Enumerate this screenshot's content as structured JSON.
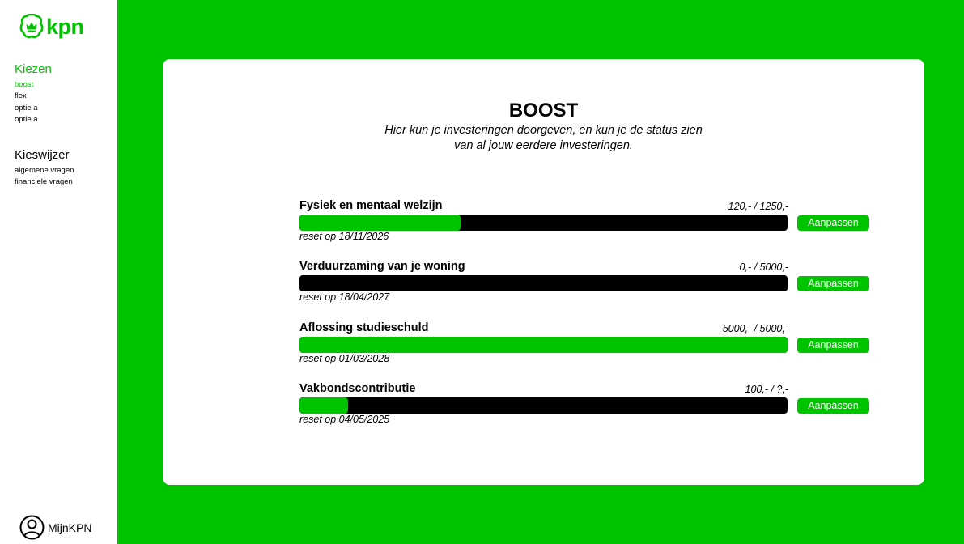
{
  "brand": {
    "name": "kpn",
    "color": "#00c300",
    "logo_icon": "kpn-crown-logo-icon"
  },
  "sidebar": {
    "groups": [
      {
        "title": "Kiezen",
        "items": [
          {
            "label": "boost",
            "active": true
          },
          {
            "label": "flex"
          },
          {
            "label": "optie a"
          },
          {
            "label": "optie a"
          }
        ]
      },
      {
        "title": "Kieswijzer",
        "items": [
          {
            "label": "algemene vragen"
          },
          {
            "label": "financiele vragen"
          }
        ]
      }
    ],
    "account": {
      "label": "MijnKPN",
      "icon": "user-avatar-icon"
    }
  },
  "main": {
    "title": "BOOST",
    "subtitle_lines": [
      "Hier kun je investeringen doorgeven, en kun je de status zien",
      "van al jouw eerdere investeringen."
    ],
    "goals": [
      {
        "name": "Fysiek en mentaal welzijn",
        "amount": "120,- / 1250,-",
        "progress": 0.33,
        "reset": "reset op 18/11/2026",
        "button": "Aanpassen"
      },
      {
        "name": "Verduurzaming van je woning",
        "amount": "0,- / 5000,-",
        "progress": 0,
        "reset": "reset op 18/04/2027",
        "button": "Aanpassen"
      },
      {
        "name": "Aflossing studieschuld",
        "amount": "5000,- / 5000,-",
        "progress": 1,
        "reset": "reset op 01/03/2028",
        "button": "Aanpassen"
      },
      {
        "name": "Vakbondscontributie",
        "amount": "100,- / ?,-",
        "progress": 0.1,
        "reset": "reset op 04/05/2025",
        "button": "Aanpassen"
      }
    ]
  },
  "colors": {
    "accent": "#00c300",
    "bar_track": "#000000",
    "panel": "#ffffff"
  }
}
